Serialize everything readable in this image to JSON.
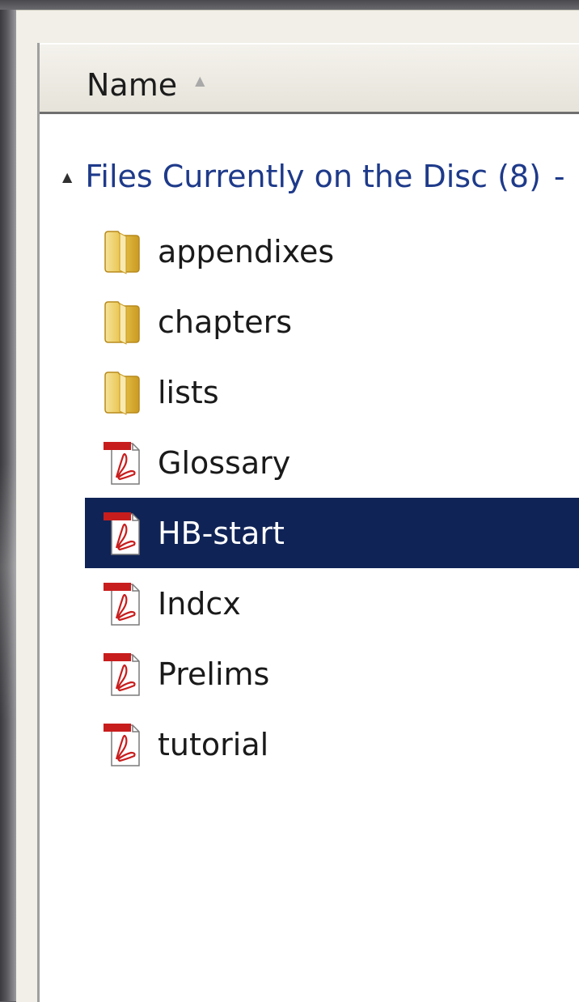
{
  "header": {
    "name_label": "Name",
    "sort_arrow": "▲"
  },
  "group": {
    "title": "Files Currently on the Disc (8)",
    "collapse_arrow": "▲",
    "dash": "-"
  },
  "files": [
    {
      "name": "appendixes",
      "icon": "folder-icon"
    },
    {
      "name": "chapters",
      "icon": "folder-icon"
    },
    {
      "name": "lists",
      "icon": "folder-icon"
    },
    {
      "name": "Glossary",
      "icon": "pdf-icon"
    },
    {
      "name": "HB-start",
      "icon": "pdf-icon",
      "selected": true
    },
    {
      "name": "Indcx",
      "icon": "pdf-icon"
    },
    {
      "name": "Prelims",
      "icon": "pdf-icon"
    },
    {
      "name": "tutorial",
      "icon": "pdf-icon"
    }
  ],
  "colors": {
    "selection": "#0f2356",
    "group_text": "#1e3a8a",
    "folder": "#e8c24a",
    "pdf_red": "#c81d1d"
  }
}
